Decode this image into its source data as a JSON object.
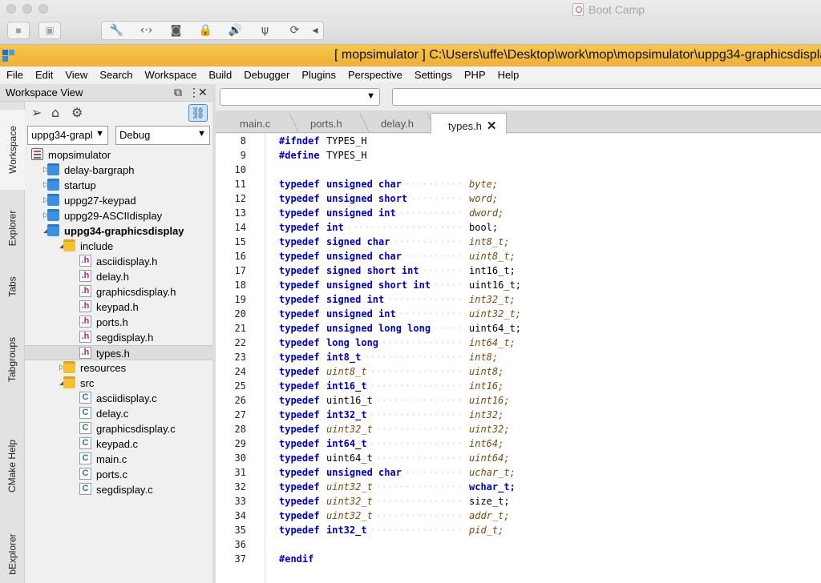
{
  "mac": {
    "window_title": "Boot Camp"
  },
  "app": {
    "title": "[ mopsimulator ] C:\\Users\\uffe\\Desktop\\work\\mop\\mopsimulator\\uppg34-graphicsdisplay"
  },
  "menu": [
    "File",
    "Edit",
    "View",
    "Search",
    "Workspace",
    "Build",
    "Debugger",
    "Plugins",
    "Perspective",
    "Settings",
    "PHP",
    "Help"
  ],
  "workspace": {
    "title": "Workspace View",
    "project_select": "uppg34-grapl",
    "config_select": "Debug",
    "side_tabs": [
      "Workspace",
      "Explorer",
      "Tabs",
      "Tabgroups",
      "CMake Help",
      "bExplorer"
    ],
    "tree": [
      {
        "label": "mopsimulator",
        "icon": "workspace-icon",
        "depth": 0,
        "exp": ""
      },
      {
        "label": "delay-bargraph",
        "icon": "folder-icon",
        "depth": 1,
        "exp": "▷"
      },
      {
        "label": "startup",
        "icon": "folder-icon",
        "depth": 1,
        "exp": "▷"
      },
      {
        "label": "uppg27-keypad",
        "icon": "folder-icon",
        "depth": 1,
        "exp": "▷"
      },
      {
        "label": "uppg29-ASCIIdisplay",
        "icon": "folder-icon",
        "depth": 1,
        "exp": "▷"
      },
      {
        "label": "uppg34-graphicsdisplay",
        "icon": "folder-icon",
        "depth": 1,
        "exp": "◢",
        "bold": true
      },
      {
        "label": "include",
        "icon": "yellow-folder-icon",
        "depth": 2,
        "exp": "◢"
      },
      {
        "label": "asciidisplay.h",
        "icon": "h-file-icon",
        "depth": 3,
        "exp": ""
      },
      {
        "label": "delay.h",
        "icon": "h-file-icon",
        "depth": 3,
        "exp": ""
      },
      {
        "label": "graphicsdisplay.h",
        "icon": "h-file-icon",
        "depth": 3,
        "exp": ""
      },
      {
        "label": "keypad.h",
        "icon": "h-file-icon",
        "depth": 3,
        "exp": ""
      },
      {
        "label": "ports.h",
        "icon": "h-file-icon",
        "depth": 3,
        "exp": ""
      },
      {
        "label": "segdisplay.h",
        "icon": "h-file-icon",
        "depth": 3,
        "exp": ""
      },
      {
        "label": "types.h",
        "icon": "h-file-icon",
        "depth": 3,
        "exp": "",
        "selected": true
      },
      {
        "label": "resources",
        "icon": "yellow-folder-icon",
        "depth": 2,
        "exp": "▷"
      },
      {
        "label": "src",
        "icon": "yellow-folder-icon",
        "depth": 2,
        "exp": "◢"
      },
      {
        "label": "asciidisplay.c",
        "icon": "c-file-icon",
        "depth": 3,
        "exp": ""
      },
      {
        "label": "delay.c",
        "icon": "c-file-icon",
        "depth": 3,
        "exp": ""
      },
      {
        "label": "graphicsdisplay.c",
        "icon": "c-file-icon",
        "depth": 3,
        "exp": ""
      },
      {
        "label": "keypad.c",
        "icon": "c-file-icon",
        "depth": 3,
        "exp": ""
      },
      {
        "label": "main.c",
        "icon": "c-file-icon",
        "depth": 3,
        "exp": ""
      },
      {
        "label": "ports.c",
        "icon": "c-file-icon",
        "depth": 3,
        "exp": ""
      },
      {
        "label": "segdisplay.c",
        "icon": "c-file-icon",
        "depth": 3,
        "exp": ""
      }
    ]
  },
  "editor": {
    "tabs": [
      {
        "label": "main.c",
        "active": false
      },
      {
        "label": "ports.h",
        "active": false
      },
      {
        "label": "delay.h",
        "active": false
      },
      {
        "label": "types.h",
        "active": true
      }
    ],
    "lines": [
      {
        "n": "8",
        "a": "#ifndef",
        "b": "TYPES_H",
        "c": ""
      },
      {
        "n": "9",
        "a": "#define",
        "b": "TYPES_H",
        "c": ""
      },
      {
        "n": "10",
        "a": "",
        "b": "",
        "c": ""
      },
      {
        "n": "11",
        "a": "typedef",
        "b": "unsigned char",
        "c": "byte;"
      },
      {
        "n": "12",
        "a": "typedef",
        "b": "unsigned short",
        "c": "word;"
      },
      {
        "n": "13",
        "a": "typedef",
        "b": "unsigned int",
        "c": "dword;"
      },
      {
        "n": "14",
        "a": "typedef",
        "b": "int",
        "c": "bool;"
      },
      {
        "n": "15",
        "a": "typedef",
        "b": "signed char",
        "c": "int8_t;"
      },
      {
        "n": "16",
        "a": "typedef",
        "b": "unsigned char",
        "c": "uint8_t;"
      },
      {
        "n": "17",
        "a": "typedef",
        "b": "signed short int",
        "c": "int16_t;"
      },
      {
        "n": "18",
        "a": "typedef",
        "b": "unsigned short int",
        "c": "uint16_t;"
      },
      {
        "n": "19",
        "a": "typedef",
        "b": "signed int",
        "c": "int32_t;"
      },
      {
        "n": "20",
        "a": "typedef",
        "b": "unsigned int",
        "c": "uint32_t;"
      },
      {
        "n": "21",
        "a": "typedef",
        "b": "unsigned long long",
        "c": "uint64_t;"
      },
      {
        "n": "22",
        "a": "typedef",
        "b": "long long",
        "c": "int64_t;"
      },
      {
        "n": "23",
        "a": "typedef",
        "b": "int8_t",
        "c": "int8;"
      },
      {
        "n": "24",
        "a": "typedef",
        "b": "uint8_t",
        "c": "uint8;"
      },
      {
        "n": "25",
        "a": "typedef",
        "b": "int16_t",
        "c": "int16;"
      },
      {
        "n": "26",
        "a": "typedef",
        "b": "uint16_t",
        "c": "uint16;"
      },
      {
        "n": "27",
        "a": "typedef",
        "b": "int32_t",
        "c": "int32;"
      },
      {
        "n": "28",
        "a": "typedef",
        "b": "uint32_t",
        "c": "uint32;"
      },
      {
        "n": "29",
        "a": "typedef",
        "b": "int64_t",
        "c": "int64;"
      },
      {
        "n": "30",
        "a": "typedef",
        "b": "uint64_t",
        "c": "uint64;"
      },
      {
        "n": "31",
        "a": "typedef",
        "b": "unsigned char",
        "c": "uchar_t;"
      },
      {
        "n": "32",
        "a": "typedef",
        "b": "uint32_t",
        "c": "wchar_t;"
      },
      {
        "n": "33",
        "a": "typedef",
        "b": "uint32_t",
        "c": "size_t;"
      },
      {
        "n": "34",
        "a": "typedef",
        "b": "uint32_t",
        "c": "addr_t;"
      },
      {
        "n": "35",
        "a": "typedef",
        "b": "int32_t",
        "c": "pid_t;"
      },
      {
        "n": "36",
        "a": "",
        "b": "",
        "c": ""
      },
      {
        "n": "37",
        "a": "#endif",
        "b": "",
        "c": ""
      }
    ]
  },
  "colors": {
    "title_bar": "#f3bb43",
    "keyword": "#0000c8",
    "type_ref": "#7a4a10",
    "selection": "#dcdcdc"
  }
}
